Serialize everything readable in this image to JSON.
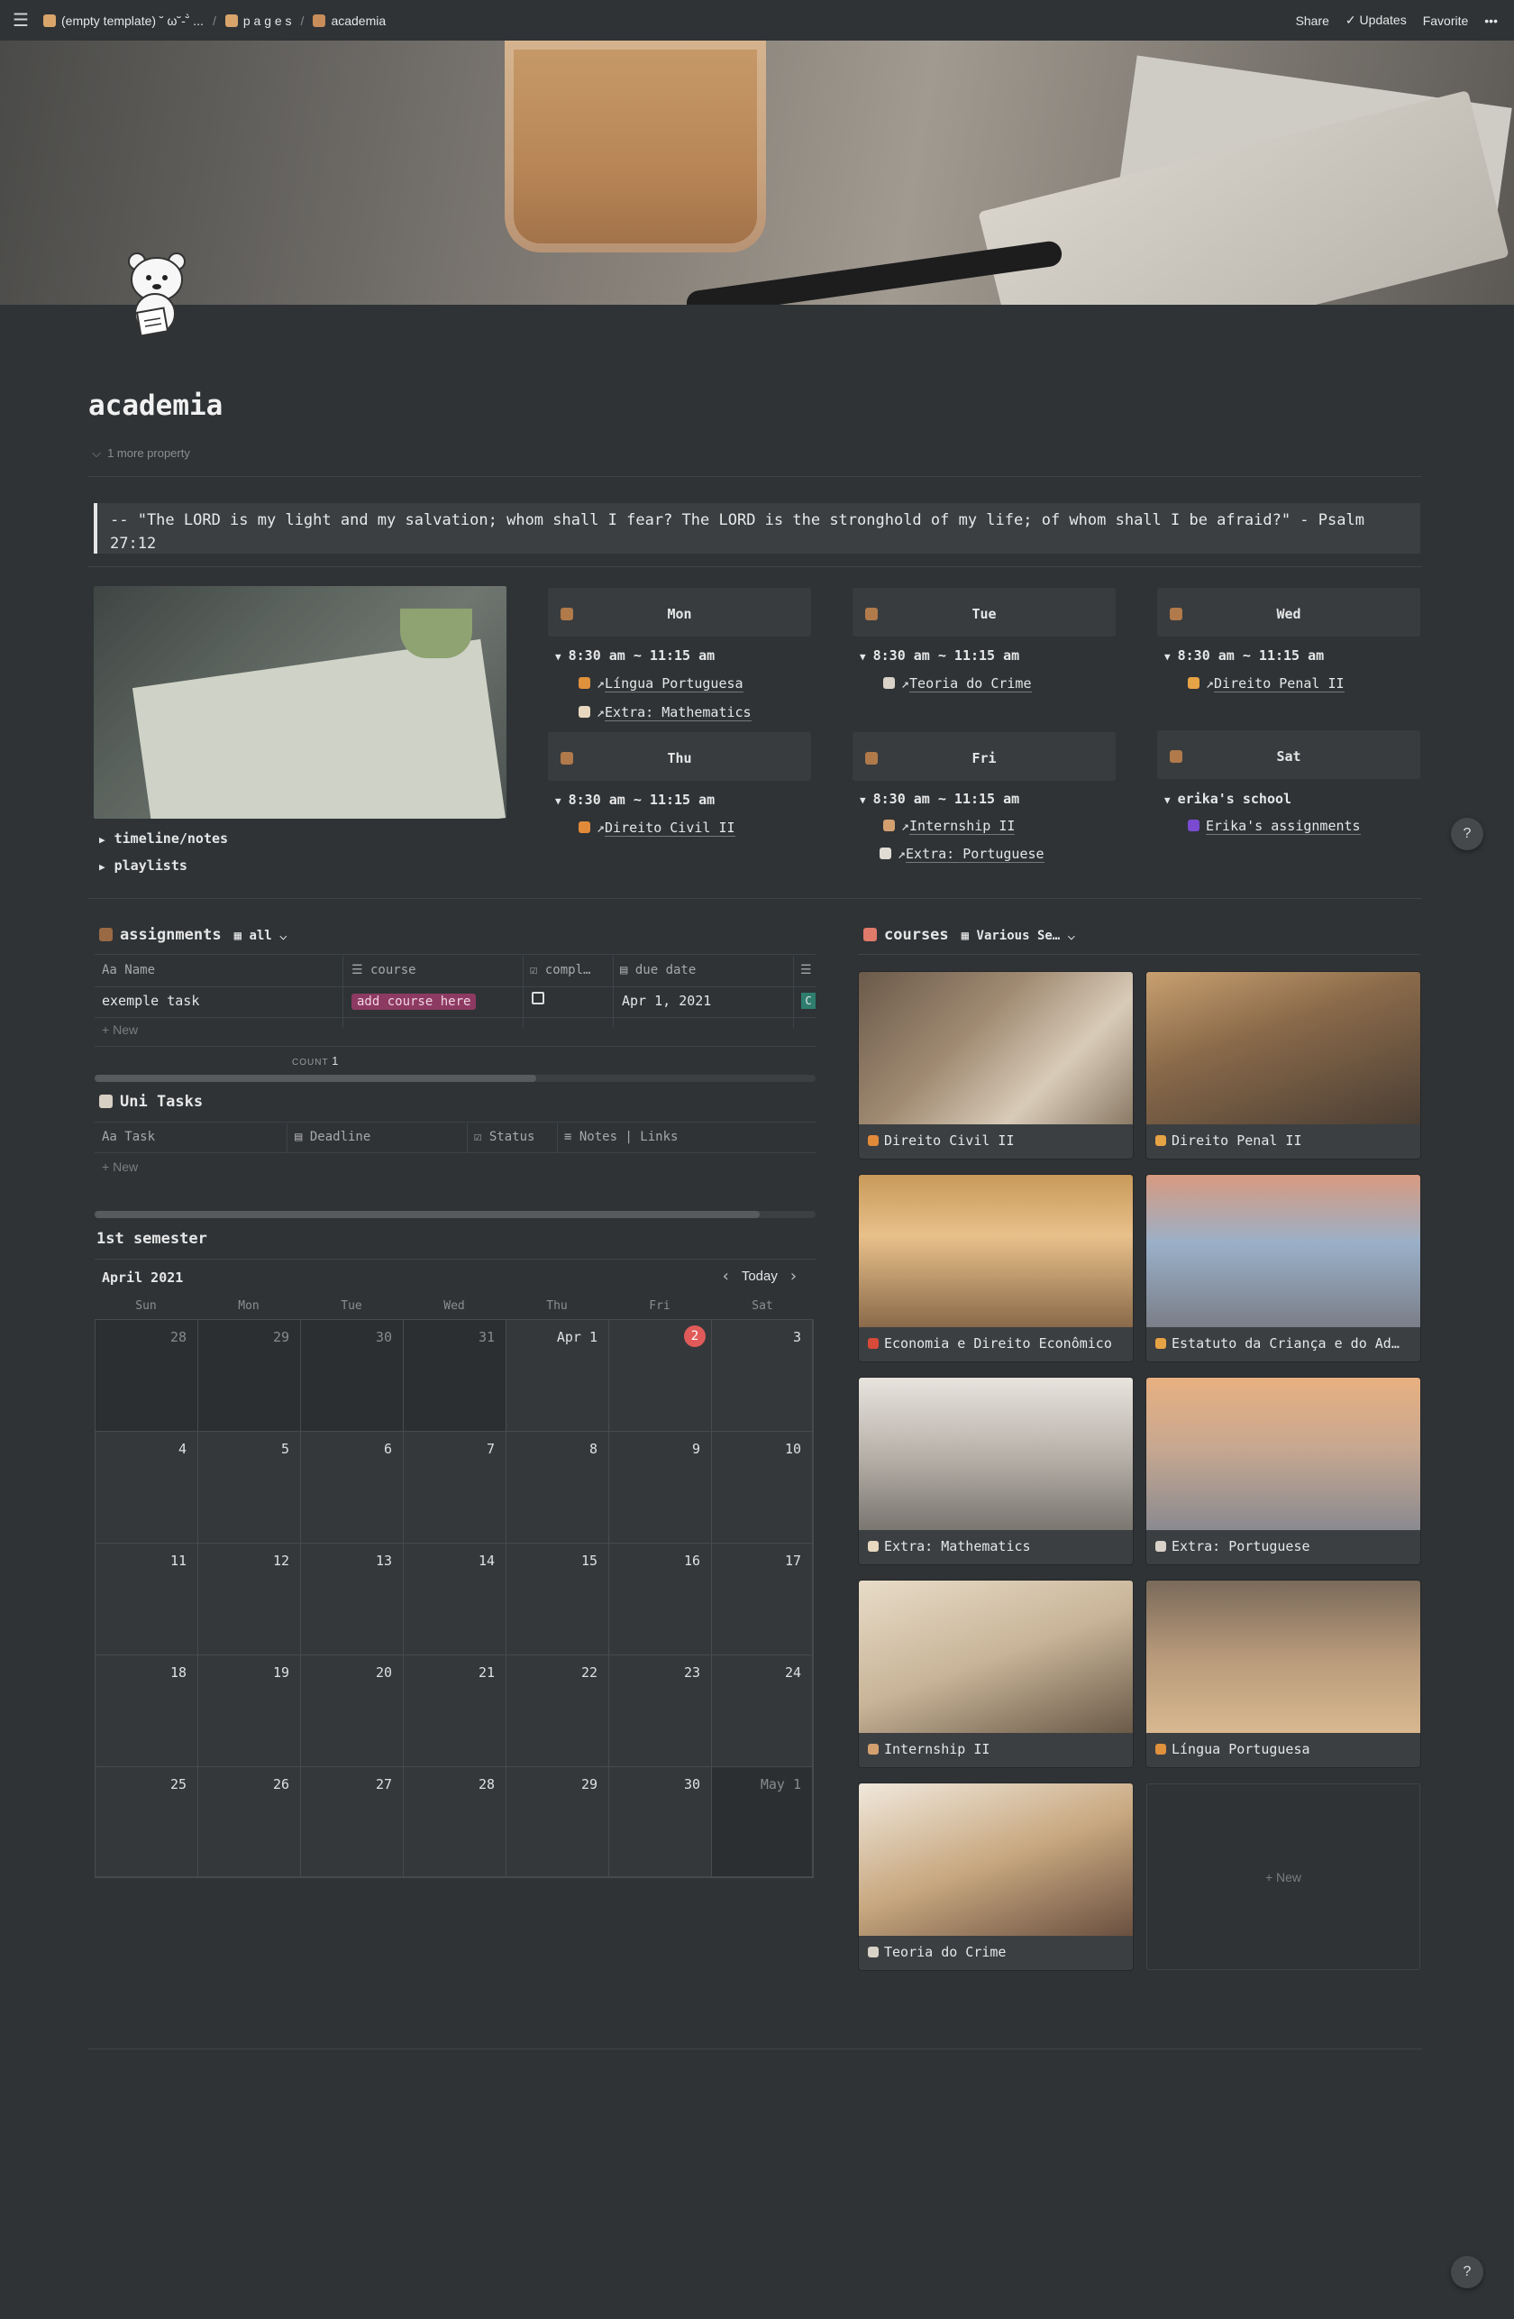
{
  "topbar": {
    "breadcrumbs": [
      "(empty template) ˘ ω˘-˘̀ ...",
      "p a g e s",
      "academia"
    ],
    "share": "Share",
    "updates": "Updates",
    "favorite": "Favorite",
    "more": "•••"
  },
  "page": {
    "title": "academia",
    "more_property": "1 more property",
    "quote": "-- \"The LORD is my light and my salvation; whom shall I fear? The LORD is the stronghold of my life; of whom shall I be afraid?\" - Psalm 27:12"
  },
  "toggles": [
    "timeline/notes",
    "playlists"
  ],
  "schedule": {
    "mon": {
      "day": "Mon",
      "time": "8:30 am ~ 11:15 am",
      "items": [
        "Língua Portuguesa",
        "Extra: Mathematics"
      ]
    },
    "tue": {
      "day": "Tue",
      "time": "8:30 am ~ 11:15 am",
      "items": [
        "Teoria do Crime"
      ]
    },
    "wed": {
      "day": "Wed",
      "time": "8:30 am ~ 11:15 am",
      "items": [
        "Direito Penal II"
      ]
    },
    "thu": {
      "day": "Thu",
      "time": "8:30 am ~ 11:15 am",
      "items": [
        "Direito Civil II"
      ]
    },
    "fri": {
      "day": "Fri",
      "time": "8:30 am ~ 11:15 am",
      "items": [
        "Internship II",
        "Extra: Portuguese"
      ]
    },
    "sat": {
      "day": "Sat",
      "time": "erika's school",
      "items": [
        "Erika's assignments"
      ]
    }
  },
  "assignments": {
    "title": "assignments",
    "view": "all",
    "columns": [
      "Name",
      "course",
      "compl…",
      "due date"
    ],
    "row": {
      "name": "exemple task",
      "course": "add course here",
      "due": "Apr 1, 2021",
      "extra": "C"
    },
    "new": "New",
    "count_label": "COUNT",
    "count_value": "1"
  },
  "unitasks": {
    "title": "Uni Tasks",
    "columns": [
      "Task",
      "Deadline",
      "Status",
      "Notes | Links"
    ],
    "new": "New"
  },
  "calendar": {
    "title": "1st semester",
    "month": "April 2021",
    "today_btn": "Today",
    "days": [
      "Sun",
      "Mon",
      "Tue",
      "Wed",
      "Thu",
      "Fri",
      "Sat"
    ],
    "weeks": [
      [
        "28",
        "29",
        "30",
        "31",
        "Apr 1",
        "2",
        "3"
      ],
      [
        "4",
        "5",
        "6",
        "7",
        "8",
        "9",
        "10"
      ],
      [
        "11",
        "12",
        "13",
        "14",
        "15",
        "16",
        "17"
      ],
      [
        "18",
        "19",
        "20",
        "21",
        "22",
        "23",
        "24"
      ],
      [
        "25",
        "26",
        "27",
        "28",
        "29",
        "30",
        "May 1"
      ]
    ]
  },
  "courses": {
    "title": "courses",
    "view": "Various Se…",
    "cards": [
      "Direito Civil II",
      "Direito Penal II",
      "Economia e Direito Econômico",
      "Estatuto da Criança e do Ad…",
      "Extra: Mathematics",
      "Extra: Portuguese",
      "Internship II",
      "Língua Portuguesa",
      "Teoria do Crime"
    ],
    "new": "+ New"
  },
  "help": "?"
}
